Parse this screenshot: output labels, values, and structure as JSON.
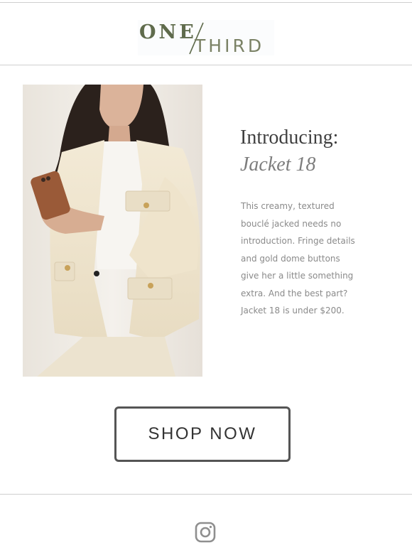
{
  "header": {
    "logo_one": "ONE",
    "logo_third": "THIRD",
    "colors": {
      "logo_dark": "#5f6b4c",
      "logo_light": "#7b8266"
    }
  },
  "hero": {
    "image": "woman-in-cream-boucle-jacket-holding-phone"
  },
  "content": {
    "intro_heading": "Introducing:",
    "product_name": "Jacket 18",
    "description_lines": [
      "This creamy, textured",
      "bouclé jacked needs no",
      "introduction. Fringe details",
      "and gold dome buttons",
      "give her a little something",
      "extra. And the best part?",
      "Jacket 18 is under $200."
    ]
  },
  "cta": {
    "shop_label": "SHOP NOW"
  },
  "footer": {
    "social_icon": "instagram-icon"
  }
}
